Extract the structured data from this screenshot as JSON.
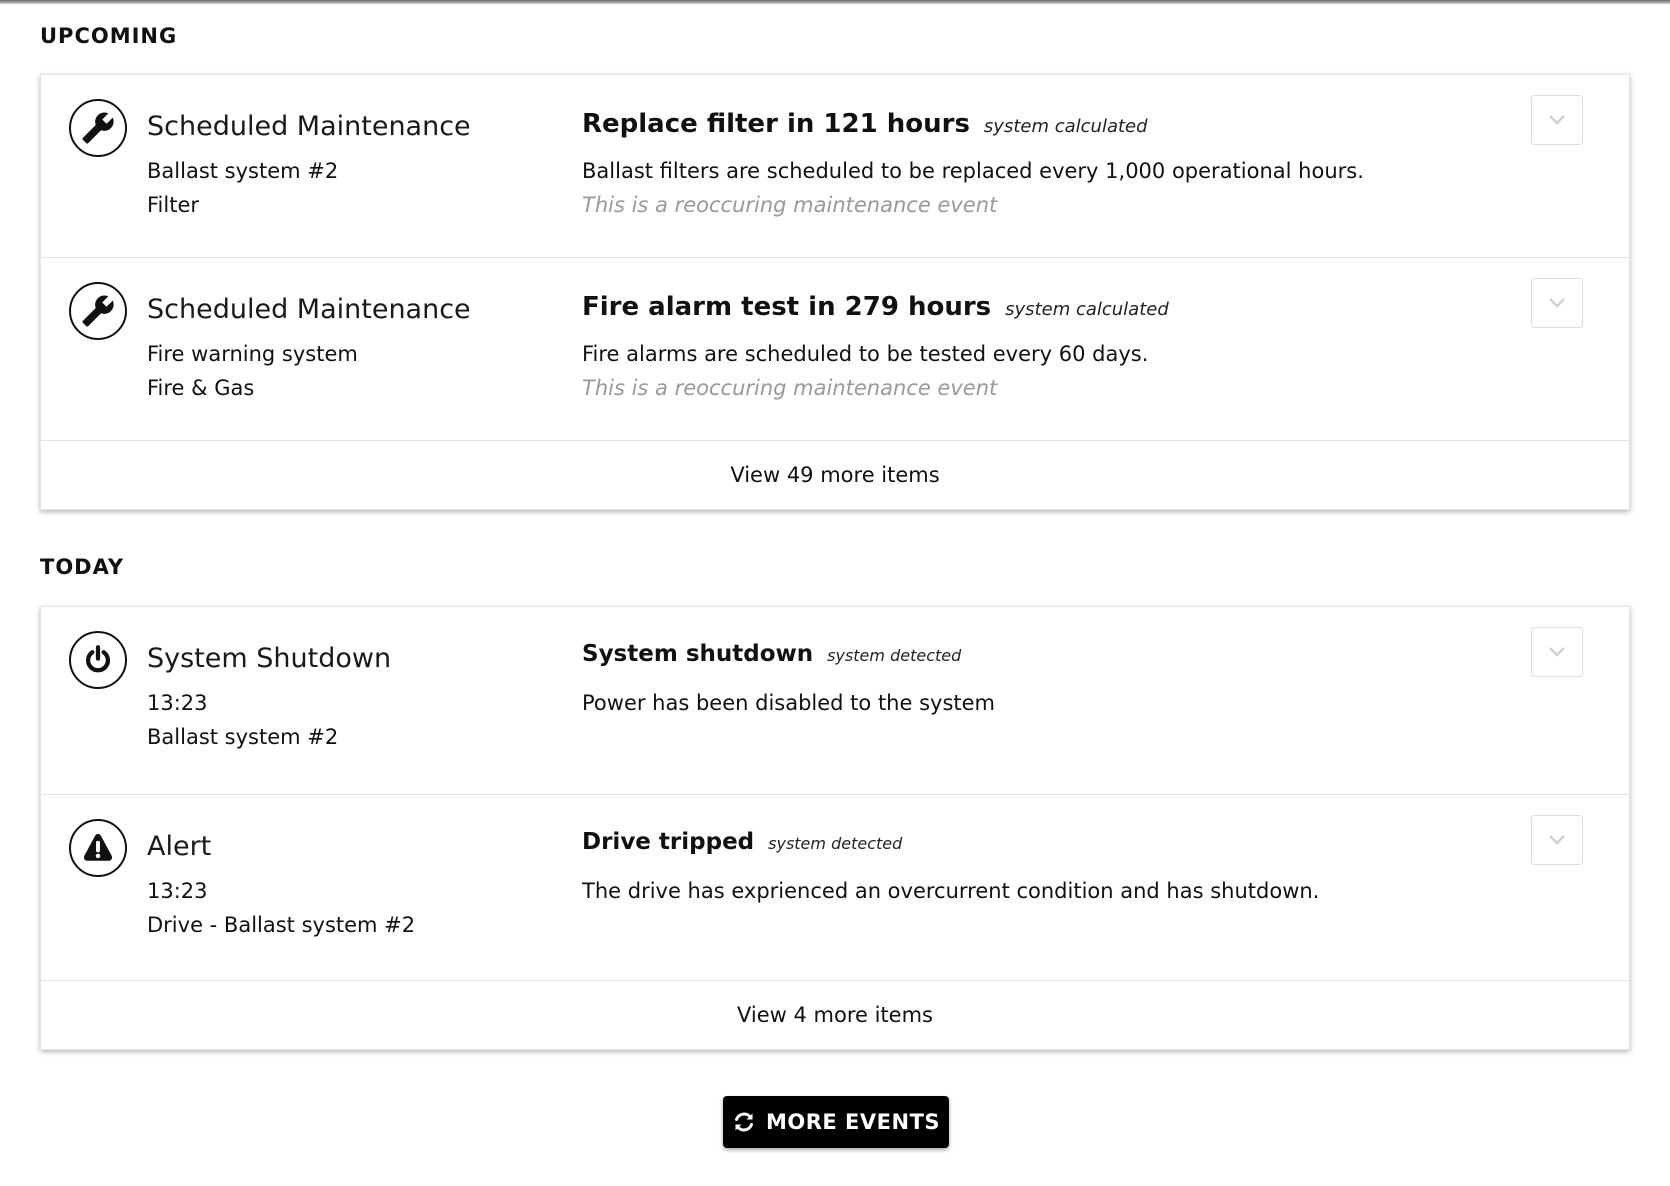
{
  "sections": {
    "upcoming": {
      "title": "UPCOMING",
      "events": [
        {
          "icon": "wrench-icon",
          "type": "Scheduled Maintenance",
          "line1": "Ballast system #2",
          "line2": "Filter",
          "title": "Replace filter in 121 hours",
          "tag": "system calculated",
          "description": "Ballast filters are scheduled to be replaced every 1,000 operational hours.",
          "note": "This is a reoccuring maintenance event"
        },
        {
          "icon": "wrench-icon",
          "type": "Scheduled Maintenance",
          "line1": "Fire warning system",
          "line2": "Fire & Gas",
          "title": "Fire alarm test in 279 hours",
          "tag": "system calculated",
          "description": "Fire alarms are scheduled to be tested every 60 days.",
          "note": "This is a reoccuring maintenance event"
        }
      ],
      "view_more": "View 49 more items"
    },
    "today": {
      "title": "TODAY",
      "events": [
        {
          "icon": "power-icon",
          "type": "System Shutdown",
          "line1": "13:23",
          "line2": "Ballast system #2",
          "title": "System shutdown",
          "tag": "system detected",
          "description": "Power has been disabled to the system"
        },
        {
          "icon": "alert-icon",
          "type": "Alert",
          "line1": "13:23",
          "line2": "Drive - Ballast system #2",
          "title": "Drive tripped",
          "tag": "system detected",
          "description": "The drive has exprienced an overcurrent condition and has shutdown."
        }
      ],
      "view_more": "View 4 more items"
    }
  },
  "more_events_label": "MORE EVENTS",
  "more_events_icon": "refresh-icon"
}
